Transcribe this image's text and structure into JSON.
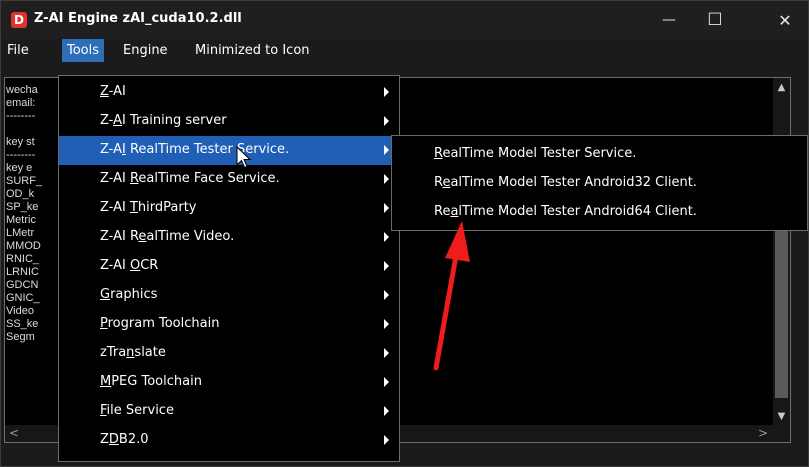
{
  "window": {
    "title": "Z-AI Engine zAI_cuda10.2.dll",
    "app_icon_letter": "D",
    "minimize_glyph": "—",
    "maximize_glyph": "☐",
    "close_glyph": "✕"
  },
  "menubar": {
    "items": [
      {
        "label": "File"
      },
      {
        "label": "Tools"
      },
      {
        "label": "Engine"
      },
      {
        "label": "Minimized to Icon"
      }
    ],
    "active": "Tools"
  },
  "log_memo": {
    "lines": [
      "wecha",
      "email:",
      "--------",
      "",
      "key st",
      "--------",
      "key e",
      "SURF_",
      "OD_k",
      "SP_ke",
      "Metric",
      "LMetr",
      "MMOD",
      "RNIC_",
      "LRNIC",
      "GDCN",
      "GNIC_",
      "Video",
      "SS_ke",
      "Segm"
    ]
  },
  "tools_menu": {
    "items": [
      {
        "pre": "",
        "u": "Z",
        "post": "-AI"
      },
      {
        "pre": "Z-",
        "u": "A",
        "post": "I Training server"
      },
      {
        "pre": "Z-A",
        "u": "I",
        "post": " RealTime Tester Service."
      },
      {
        "pre": "Z-AI ",
        "u": "R",
        "post": "ealTime Face Service."
      },
      {
        "pre": "Z-AI ",
        "u": "T",
        "post": "hirdParty"
      },
      {
        "pre": "Z-AI R",
        "u": "e",
        "post": "alTime Video."
      },
      {
        "pre": "Z-AI ",
        "u": "O",
        "post": "CR"
      },
      {
        "pre": "",
        "u": "G",
        "post": "raphics"
      },
      {
        "pre": "",
        "u": "P",
        "post": "rogram Toolchain"
      },
      {
        "pre": "zTra",
        "u": "n",
        "post": "slate"
      },
      {
        "pre": "",
        "u": "M",
        "post": "PEG Toolchain"
      },
      {
        "pre": "",
        "u": "F",
        "post": "ile Service"
      },
      {
        "pre": "Z",
        "u": "D",
        "post": "B2.0"
      }
    ],
    "highlighted": "Z-AI RealTime Tester Service."
  },
  "submenu": {
    "items": [
      {
        "pre": "",
        "u": "R",
        "post": "ealTime Model Tester Service."
      },
      {
        "pre": "R",
        "u": "e",
        "post": "alTime Model Tester Android32 Client."
      },
      {
        "pre": "Re",
        "u": "a",
        "post": "lTime Model Tester Android64 Client."
      }
    ]
  },
  "colors": {
    "menu_highlight": "#1f5fb5",
    "menubar_active": "#2e6db8",
    "annotation_arrow": "#ee1c1c"
  }
}
